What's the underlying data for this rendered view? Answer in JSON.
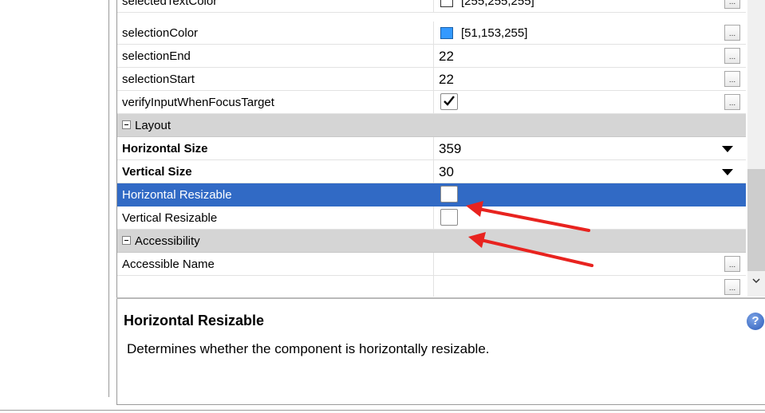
{
  "properties": {
    "rows": [
      {
        "name": "selectedTextColor",
        "value": "[255,255,255]",
        "swatch": "#ffffff"
      },
      {
        "name": "selectionColor",
        "value": "[51,153,255]",
        "swatch": "#3399ff"
      },
      {
        "name": "selectionEnd",
        "value": "22"
      },
      {
        "name": "selectionStart",
        "value": "22"
      },
      {
        "name": "verifyInputWhenFocusTarget",
        "checked": true
      },
      {
        "category": "Layout"
      },
      {
        "name": "Horizontal Size",
        "value": "359"
      },
      {
        "name": "Vertical Size",
        "value": "30"
      },
      {
        "name": "Horizontal Resizable",
        "checked": false,
        "selected": true
      },
      {
        "name": "Vertical Resizable",
        "checked": false
      },
      {
        "category": "Accessibility"
      },
      {
        "name": "Accessible Name",
        "value": ""
      }
    ]
  },
  "description": {
    "title": "Horizontal Resizable",
    "text": "Determines whether the component is horizontally resizable."
  },
  "colors": {
    "selection_row": "#316ac5",
    "category_row": "#d5d5d5",
    "annotation_arrow": "#e8231f"
  },
  "icons": {
    "ellipsis_button": "ellipsis-icon",
    "dropdown": "chevron-down-icon",
    "help": "help-icon",
    "scroll_down": "scroll-down-icon"
  }
}
